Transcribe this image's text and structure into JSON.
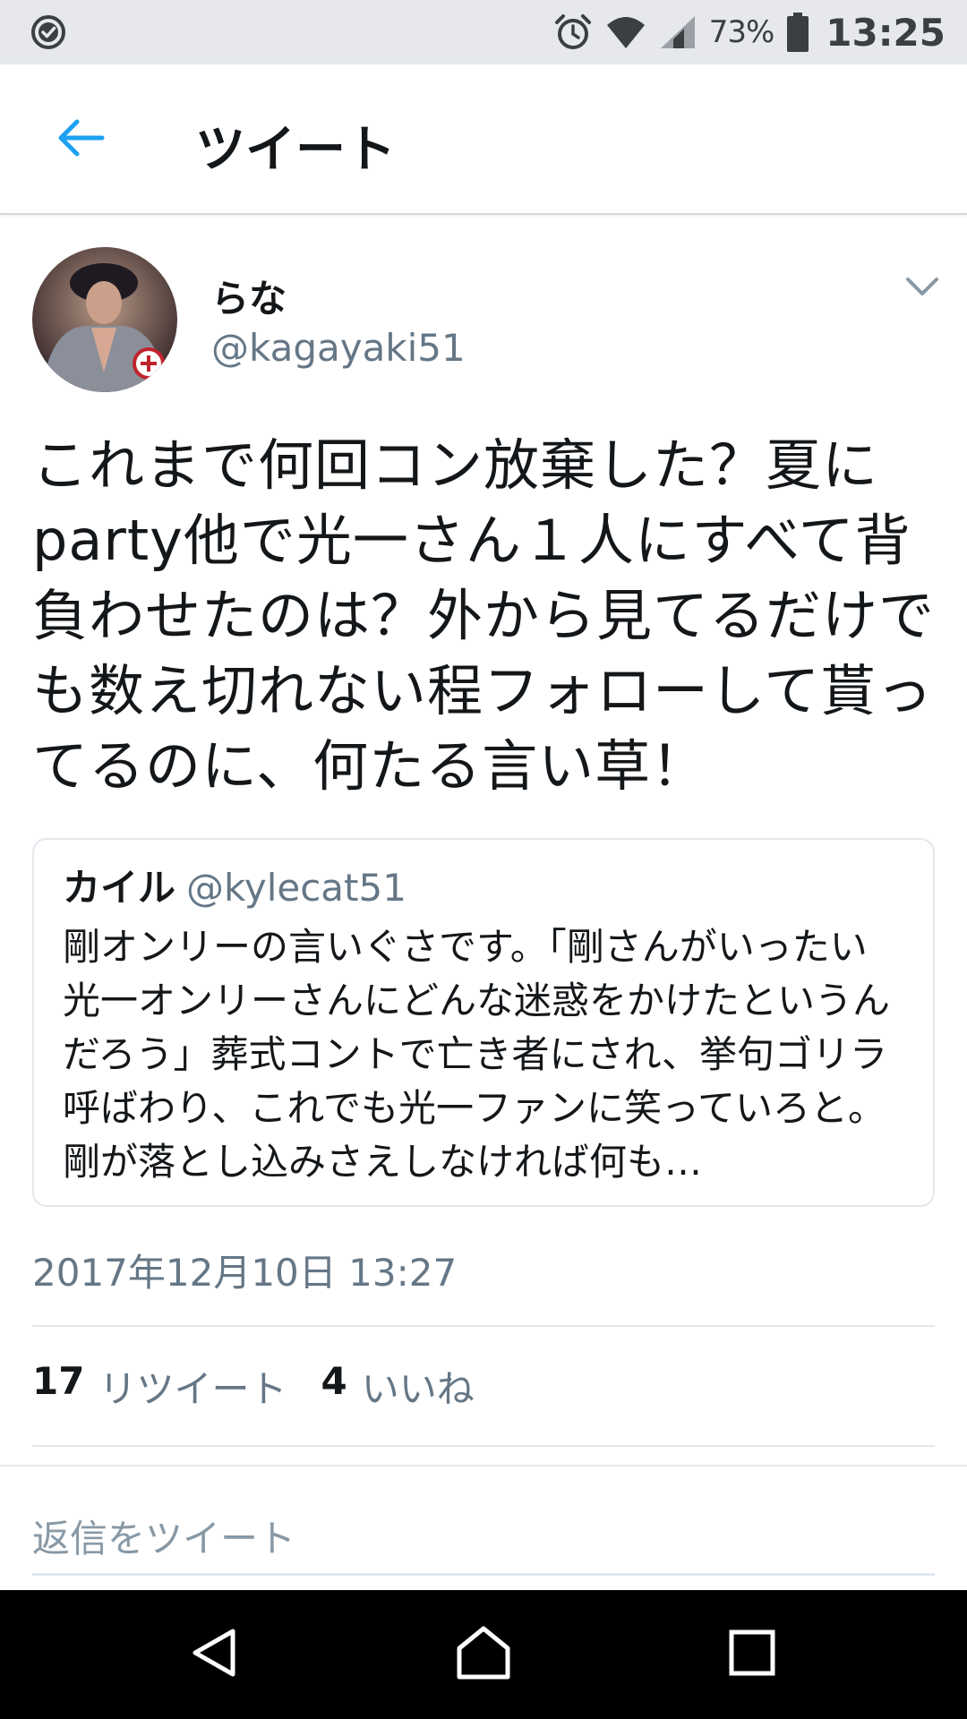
{
  "status_bar": {
    "battery_percent": "73%",
    "time": "13:25",
    "icons": [
      "check-circle-icon",
      "alarm-icon",
      "wifi-icon",
      "signal-icon",
      "battery-icon"
    ]
  },
  "header": {
    "back_icon": "arrow-left-icon",
    "title": "ツイート"
  },
  "tweet": {
    "author_name": "らな",
    "author_handle": "@kagayaki51",
    "text": "これまで何回コン放棄した？夏にparty他で光一さん１人にすべて背負わせたのは？外から見てるだけでも数え切れない程フォローして貰ってるのに、何たる言い草！",
    "quoted": {
      "name": "カイル",
      "handle": "@kylecat51",
      "text": "剛オンリーの言いぐさです。「剛さんがいったい光一オンリーさんにどんな迷惑をかけたというんだろう」葬式コントで亡き者にされ、挙句ゴリラ呼ばわり、これでも光一ファンに笑っていろと。剛が落とし込みさえしなければ何も…"
    },
    "timestamp": "2017年12月10日 13:27",
    "retweets": {
      "count": "17",
      "label": "リツイート"
    },
    "likes": {
      "count": "4",
      "label": "いいね"
    }
  },
  "reply": {
    "placeholder": "返信をツイート"
  },
  "navigation": {
    "icons": [
      "back-triangle-icon",
      "home-icon",
      "recents-square-icon"
    ]
  },
  "colors": {
    "accent": "#1da1f2",
    "text": "#14171a",
    "secondary_text": "#657786",
    "border": "#e1e8ed",
    "status_bar_bg": "#e6e8eb",
    "nav_bar_bg": "#000000"
  }
}
